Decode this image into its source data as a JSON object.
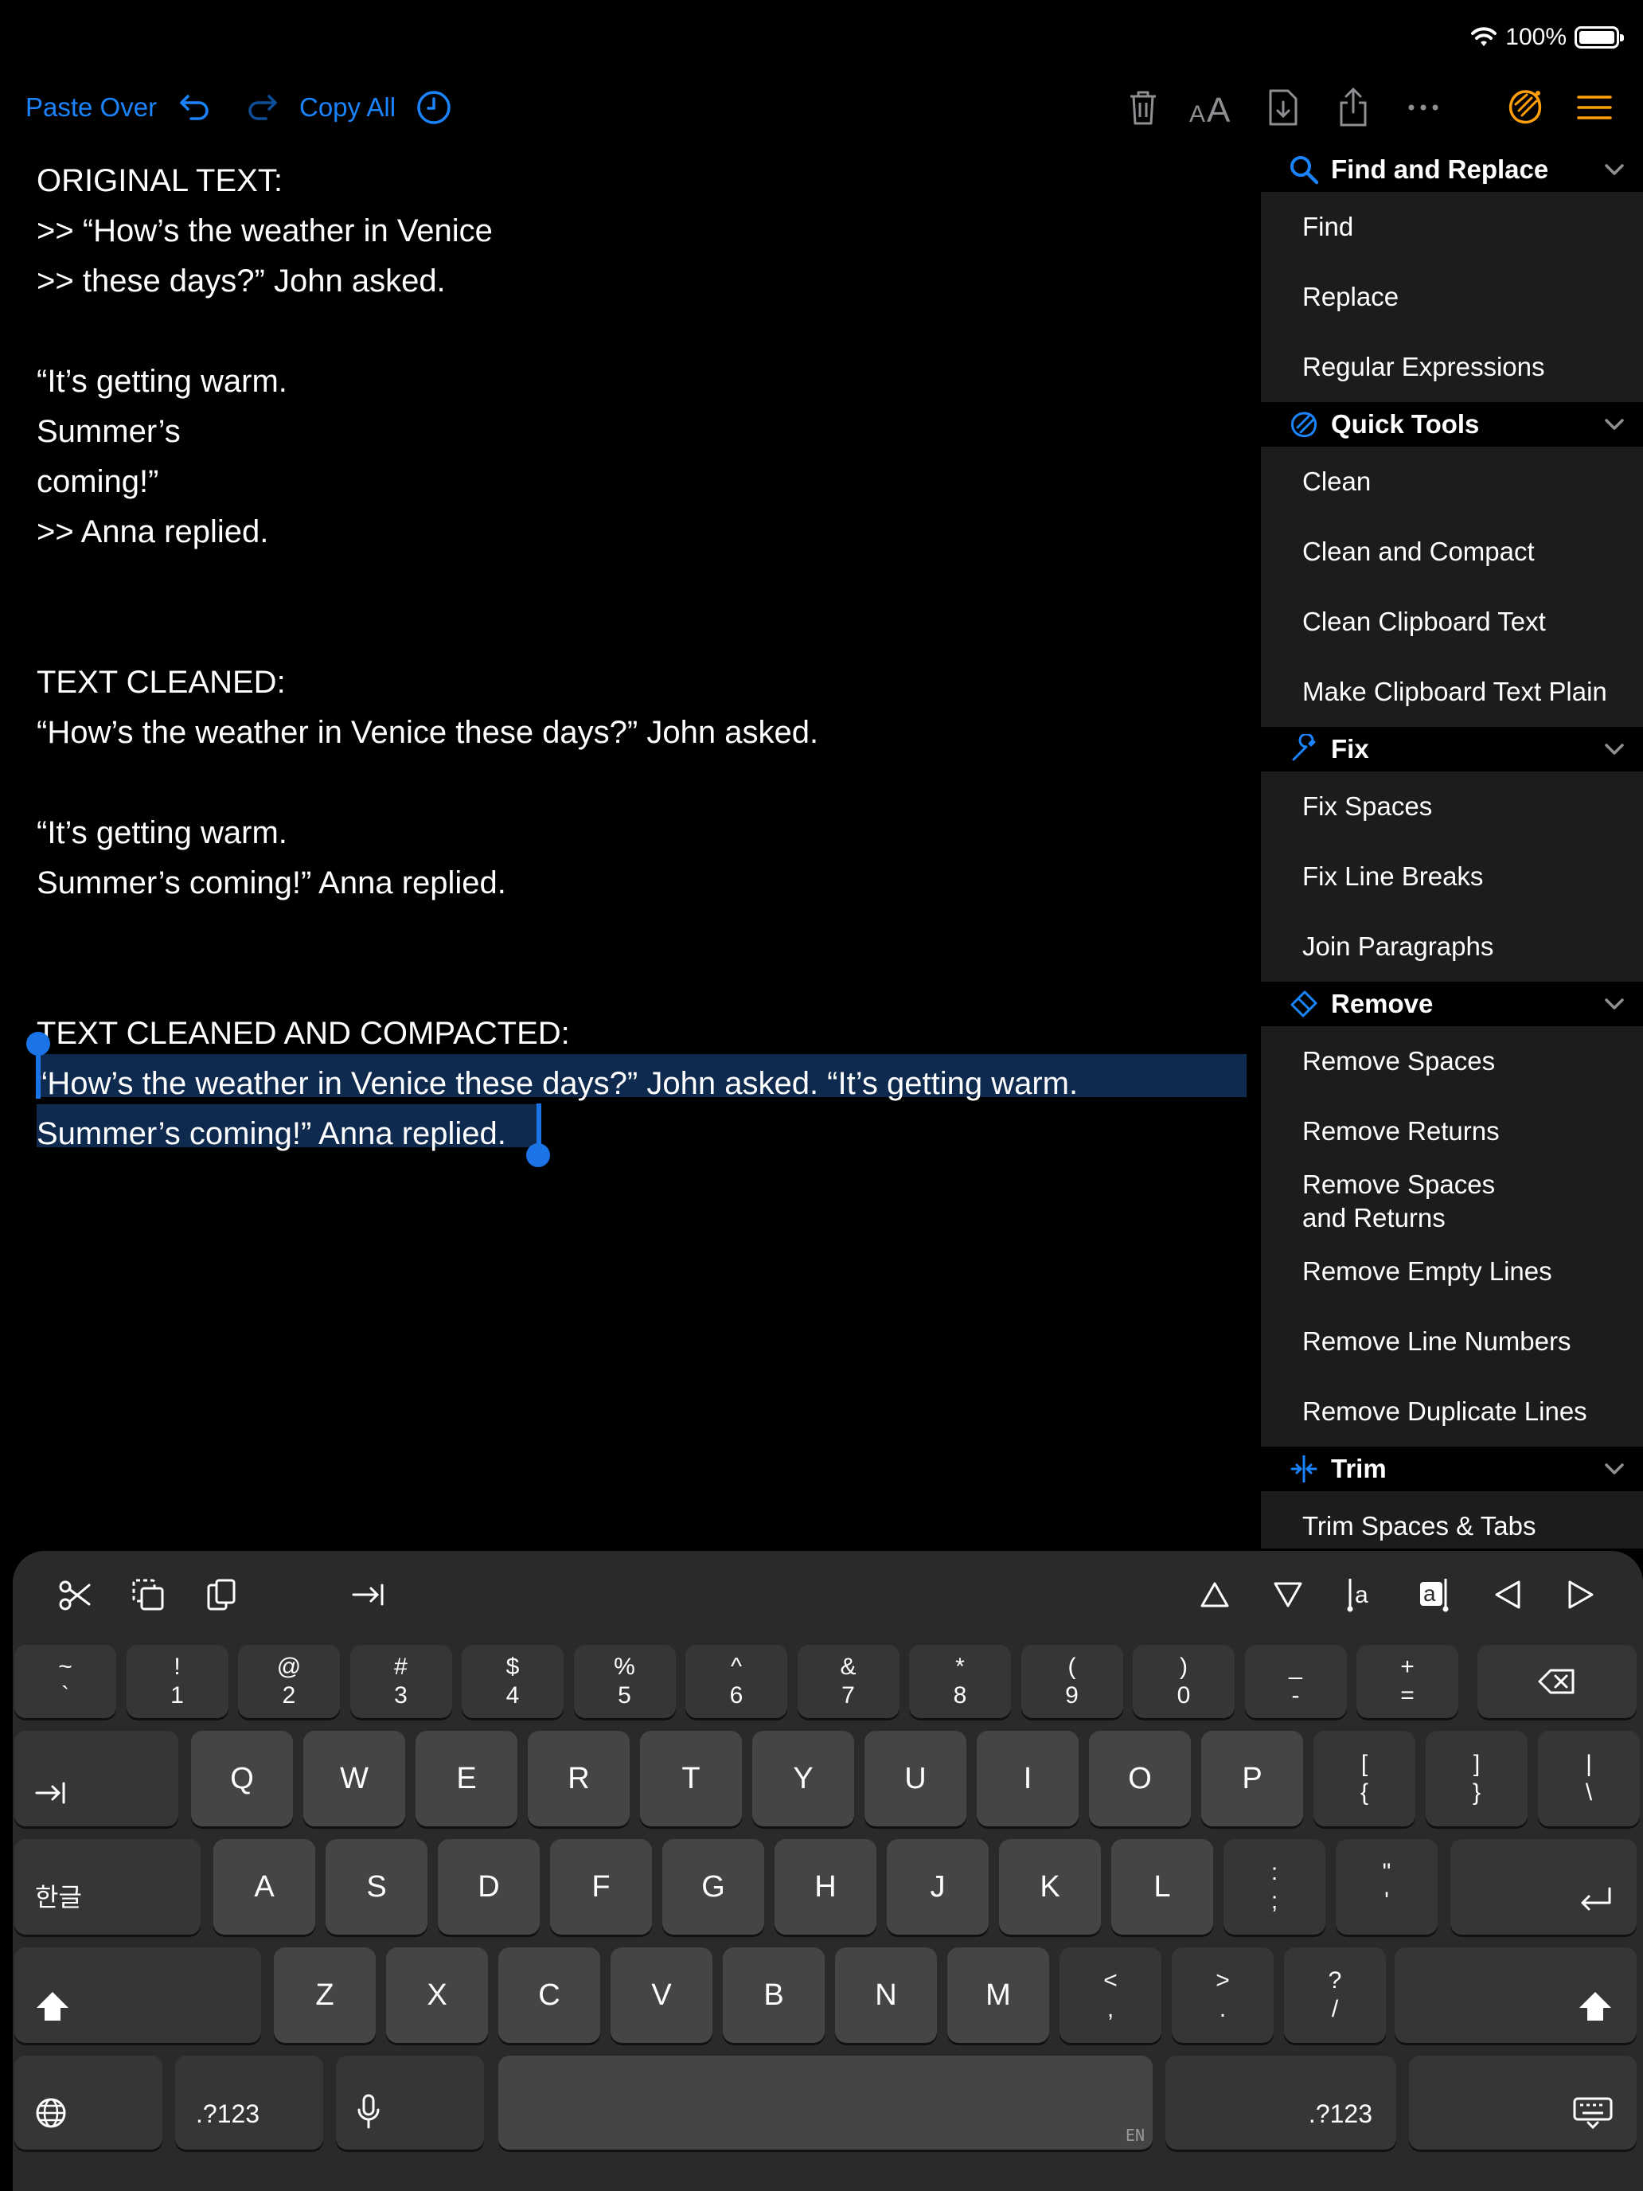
{
  "status_bar": {
    "battery": "100%"
  },
  "toolbar": {
    "paste_over": "Paste Over",
    "copy_all": "Copy All"
  },
  "editor": {
    "lines": [
      "ORIGINAL TEXT:",
      ">> “How’s the weather in Venice",
      ">> these days?” John asked.",
      "",
      "“It’s getting warm.",
      "Summer’s",
      "coming!”",
      ">> Anna replied.",
      "",
      "",
      "TEXT CLEANED:",
      "“How’s the weather in Venice these days?” John asked.",
      "",
      "“It’s getting warm.",
      "Summer’s coming!” Anna replied.",
      "",
      "",
      "TEXT CLEANED AND COMPACTED:",
      "“How’s the weather in Venice these days?” John asked. “It’s getting warm.",
      "Summer’s coming!” Anna replied."
    ]
  },
  "sidebar": {
    "sections": [
      {
        "title": "Find and Replace",
        "icon": "search-icon",
        "items": [
          "Find",
          "Replace",
          "Regular Expressions"
        ]
      },
      {
        "title": "Quick Tools",
        "icon": "quick-tools-icon",
        "items": [
          "Clean",
          "Clean and Compact",
          "Clean Clipboard Text",
          "Make Clipboard Text Plain"
        ]
      },
      {
        "title": "Fix",
        "icon": "wrench-icon",
        "items": [
          "Fix Spaces",
          "Fix Line Breaks",
          "Join Paragraphs"
        ]
      },
      {
        "title": "Remove",
        "icon": "eraser-icon",
        "items": [
          "Remove Spaces",
          "Remove Returns",
          "Remove Spaces\nand Returns",
          "Remove Empty Lines",
          "Remove Line Numbers",
          "Remove Duplicate Lines"
        ]
      },
      {
        "title": "Trim",
        "icon": "trim-icon",
        "items": [
          "Trim Spaces & Tabs"
        ]
      }
    ]
  },
  "keyboard": {
    "row1": [
      [
        "~",
        "`"
      ],
      [
        "!",
        "1"
      ],
      [
        "@",
        "2"
      ],
      [
        "#",
        "3"
      ],
      [
        "$",
        "4"
      ],
      [
        "%",
        "5"
      ],
      [
        "^",
        "6"
      ],
      [
        "&",
        "7"
      ],
      [
        "*",
        "8"
      ],
      [
        "(",
        "9"
      ],
      [
        ")",
        "0"
      ],
      [
        "_",
        "-"
      ],
      [
        "+",
        "="
      ]
    ],
    "row2": [
      "Q",
      "W",
      "E",
      "R",
      "T",
      "Y",
      "U",
      "I",
      "O",
      "P"
    ],
    "row2_extra": [
      [
        "[",
        "{"
      ],
      [
        "]",
        "}"
      ],
      [
        "|",
        "\\"
      ]
    ],
    "row3": [
      "A",
      "S",
      "D",
      "F",
      "G",
      "H",
      "J",
      "K",
      "L"
    ],
    "row3_extra": [
      [
        ":",
        ";"
      ],
      [
        "\"",
        "'"
      ]
    ],
    "row4": [
      "Z",
      "X",
      "C",
      "V",
      "B",
      "N",
      "M"
    ],
    "row4_extra": [
      [
        "<",
        ","
      ],
      [
        ">",
        "."
      ],
      [
        "?",
        "/"
      ]
    ],
    "lang_key": "한글",
    "num_key": ".?123",
    "space_lang": "EN"
  },
  "colors": {
    "accent": "#1a84ff",
    "orange": "#ff9f0a",
    "selection": "#0f2a4f"
  }
}
